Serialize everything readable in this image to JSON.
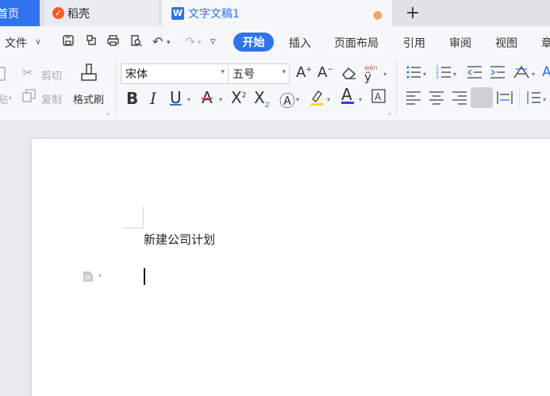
{
  "tabs": {
    "home": "首页",
    "daoke": "稻壳",
    "doc": "文字文稿1",
    "add": "+"
  },
  "menu": {
    "file": "文件",
    "start": "开始",
    "insert": "插入",
    "layout": "页面布局",
    "references": "引用",
    "review": "审阅",
    "view": "视图",
    "chapter": "章"
  },
  "ribbon": {
    "cut": "剪切",
    "copy": "复制",
    "format_painter": "格式刷",
    "paste_partial": "贴",
    "font_name": "宋体",
    "font_size": "五号"
  },
  "document": {
    "line1": "新建公司计划"
  },
  "colors": {
    "accent": "#2f73f0",
    "page": "#ffffff",
    "canvas": "#e8eaed",
    "unsaved_dot": "#f5a25d",
    "daoke_logo": "#ff5b24"
  }
}
